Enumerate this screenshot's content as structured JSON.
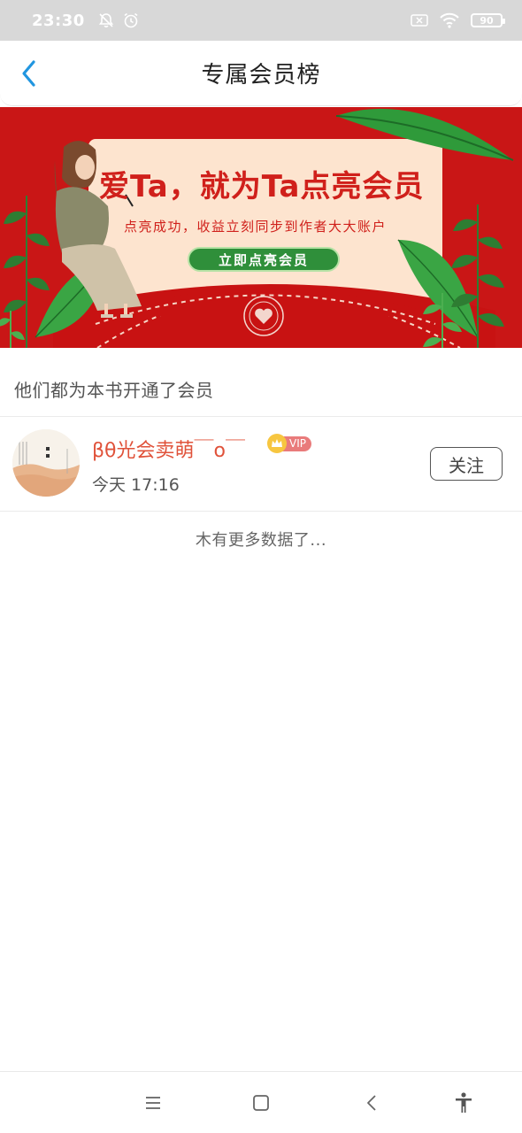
{
  "status_bar": {
    "time": "23:30",
    "left_icons": [
      "bell-off-icon",
      "alarm-icon"
    ],
    "right_icons": [
      "no-sim-icon",
      "wifi-icon",
      "battery-icon"
    ],
    "battery_level": "90"
  },
  "header": {
    "title": "专属会员榜",
    "back_icon": "chevron-left-icon",
    "accent_color": "#2196e0"
  },
  "banner": {
    "headline": "爱Ta，就为Ta点亮会员",
    "subtext": "点亮成功，收益立刻同步到作者大大账户",
    "cta_label": "立即点亮会员",
    "background_color": "#c91616"
  },
  "section": {
    "label": "他们都为本书开通了会员"
  },
  "members": [
    {
      "name": "βθ光会卖萌￣o￣",
      "badge": "VIP",
      "time": "今天 17:16",
      "follow_label": "关注"
    }
  ],
  "list_footer": "木有更多数据了...",
  "nav_bar": {
    "icons": [
      "menu-icon",
      "home-square-icon",
      "back-triangle-icon",
      "accessibility-icon"
    ]
  }
}
